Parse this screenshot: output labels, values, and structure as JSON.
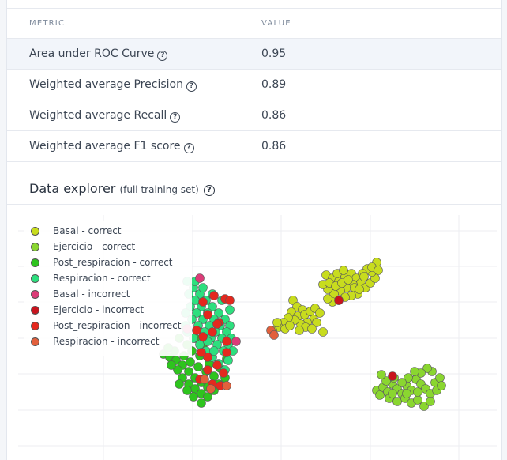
{
  "metrics_table": {
    "headers": {
      "metric": "METRIC",
      "value": "VALUE"
    },
    "rows": [
      {
        "label": "Area under ROC Curve",
        "value": "0.95"
      },
      {
        "label": "Weighted average Precision",
        "value": "0.89"
      },
      {
        "label": "Weighted average Recall",
        "value": "0.86"
      },
      {
        "label": "Weighted average F1 score",
        "value": "0.86"
      }
    ]
  },
  "help_icon_glyph": "?",
  "data_explorer": {
    "title": "Data explorer",
    "subtitle": "(full training set)"
  },
  "chart_data": {
    "type": "scatter",
    "legend_position": "top-left",
    "grid": true,
    "series": [
      {
        "name": "Basal - correct",
        "color": "#c8dc1e",
        "points": [
          [
            370,
            380
          ],
          [
            375,
            388
          ],
          [
            382,
            392
          ],
          [
            368,
            395
          ],
          [
            376,
            400
          ],
          [
            385,
            398
          ],
          [
            392,
            394
          ],
          [
            398,
            390
          ],
          [
            404,
            396
          ],
          [
            396,
            404
          ],
          [
            388,
            408
          ],
          [
            380,
            410
          ],
          [
            372,
            405
          ],
          [
            364,
            402
          ],
          [
            358,
            408
          ],
          [
            352,
            414
          ],
          [
            360,
            416
          ],
          [
            350,
            408
          ],
          [
            344,
            418
          ],
          [
            366,
            412
          ],
          [
            400,
            408
          ],
          [
            408,
            420
          ],
          [
            386,
            414
          ],
          [
            394,
            416
          ],
          [
            378,
            418
          ],
          [
            412,
            348
          ],
          [
            420,
            352
          ],
          [
            428,
            356
          ],
          [
            436,
            350
          ],
          [
            444,
            346
          ],
          [
            450,
            352
          ],
          [
            456,
            358
          ],
          [
            462,
            364
          ],
          [
            468,
            358
          ],
          [
            474,
            352
          ],
          [
            470,
            344
          ],
          [
            464,
            340
          ],
          [
            458,
            346
          ],
          [
            446,
            360
          ],
          [
            438,
            364
          ],
          [
            430,
            368
          ],
          [
            422,
            372
          ],
          [
            414,
            366
          ],
          [
            408,
            360
          ],
          [
            416,
            358
          ],
          [
            424,
            362
          ],
          [
            432,
            358
          ],
          [
            440,
            354
          ],
          [
            448,
            364
          ],
          [
            452,
            372
          ],
          [
            444,
            374
          ],
          [
            436,
            376
          ],
          [
            428,
            380
          ],
          [
            420,
            382
          ],
          [
            414,
            378
          ],
          [
            426,
            346
          ],
          [
            434,
            342
          ],
          [
            476,
            332
          ],
          [
            470,
            338
          ],
          [
            478,
            342
          ],
          [
            460,
            350
          ],
          [
            454,
            366
          ]
        ]
      },
      {
        "name": "Ejercicio - correct",
        "color": "#8ad630",
        "points": [
          [
            476,
            494
          ],
          [
            484,
            490
          ],
          [
            490,
            496
          ],
          [
            496,
            486
          ],
          [
            502,
            492
          ],
          [
            508,
            498
          ],
          [
            514,
            488
          ],
          [
            520,
            494
          ],
          [
            526,
            480
          ],
          [
            532,
            486
          ],
          [
            538,
            492
          ],
          [
            544,
            498
          ],
          [
            550,
            484
          ],
          [
            556,
            478
          ],
          [
            546,
            470
          ],
          [
            540,
            466
          ],
          [
            532,
            472
          ],
          [
            524,
            470
          ],
          [
            516,
            478
          ],
          [
            508,
            484
          ],
          [
            498,
            478
          ],
          [
            488,
            482
          ],
          [
            480,
            500
          ],
          [
            492,
            504
          ],
          [
            502,
            508
          ],
          [
            512,
            504
          ],
          [
            520,
            510
          ],
          [
            528,
            506
          ],
          [
            536,
            514
          ],
          [
            544,
            508
          ],
          [
            552,
            494
          ],
          [
            558,
            488
          ],
          [
            482,
            474
          ],
          [
            528,
            496
          ],
          [
            514,
            498
          ],
          [
            496,
            498
          ]
        ]
      },
      {
        "name": "Post_respiracion - correct",
        "color": "#2ec41e",
        "points": [
          [
            206,
            448
          ],
          [
            214,
            452
          ],
          [
            222,
            456
          ],
          [
            230,
            462
          ],
          [
            238,
            470
          ],
          [
            246,
            478
          ],
          [
            254,
            484
          ],
          [
            262,
            490
          ],
          [
            230,
            478
          ],
          [
            238,
            486
          ],
          [
            246,
            492
          ],
          [
            254,
            498
          ],
          [
            224,
            468
          ],
          [
            216,
            462
          ],
          [
            226,
            486
          ],
          [
            236,
            494
          ],
          [
            244,
            502
          ],
          [
            254,
            510
          ],
          [
            262,
            502
          ],
          [
            270,
            494
          ],
          [
            276,
            486
          ],
          [
            284,
            478
          ],
          [
            270,
            476
          ],
          [
            260,
            470
          ],
          [
            250,
            464
          ],
          [
            240,
            458
          ],
          [
            232,
            450
          ],
          [
            220,
            444
          ],
          [
            212,
            440
          ],
          [
            242,
            444
          ],
          [
            252,
            450
          ],
          [
            264,
            460
          ],
          [
            278,
            466
          ],
          [
            286,
            454
          ],
          [
            236,
            436
          ],
          [
            246,
            428
          ],
          [
            226,
            428
          ],
          [
            256,
            440
          ]
        ]
      },
      {
        "name": "Respiracion - correct",
        "color": "#2ddf7e",
        "points": [
          [
            236,
            356
          ],
          [
            244,
            364
          ],
          [
            252,
            372
          ],
          [
            260,
            380
          ],
          [
            268,
            388
          ],
          [
            276,
            396
          ],
          [
            284,
            404
          ],
          [
            290,
            412
          ],
          [
            238,
            372
          ],
          [
            246,
            380
          ],
          [
            254,
            388
          ],
          [
            262,
            396
          ],
          [
            270,
            404
          ],
          [
            278,
            412
          ],
          [
            286,
            420
          ],
          [
            240,
            388
          ],
          [
            248,
            396
          ],
          [
            256,
            404
          ],
          [
            264,
            412
          ],
          [
            272,
            420
          ],
          [
            280,
            428
          ],
          [
            288,
            436
          ],
          [
            242,
            404
          ],
          [
            250,
            412
          ],
          [
            258,
            420
          ],
          [
            266,
            428
          ],
          [
            274,
            436
          ],
          [
            282,
            444
          ],
          [
            236,
            420
          ],
          [
            244,
            428
          ],
          [
            252,
            436
          ],
          [
            260,
            444
          ],
          [
            268,
            452
          ],
          [
            276,
            460
          ],
          [
            284,
            468
          ],
          [
            290,
            392
          ],
          [
            280,
            380
          ],
          [
            268,
            372
          ],
          [
            256,
            364
          ],
          [
            246,
            356
          ],
          [
            234,
            396
          ],
          [
            234,
            412
          ],
          [
            292,
            428
          ],
          [
            294,
            444
          ],
          [
            288,
            456
          ],
          [
            262,
            432
          ],
          [
            270,
            444
          ]
        ]
      },
      {
        "name": "Basal - incorrect",
        "color": "#dc3c78",
        "points": [
          [
            252,
            352
          ],
          [
            298,
            432
          ],
          [
            236,
            416
          ]
        ]
      },
      {
        "name": "Ejercicio - incorrect",
        "color": "#c8141e",
        "points": [
          [
            428,
            380
          ],
          [
            496,
            476
          ]
        ]
      },
      {
        "name": "Post_respiracion - incorrect",
        "color": "#e4281e",
        "points": [
          [
            256,
            382
          ],
          [
            270,
            374
          ],
          [
            284,
            378
          ],
          [
            290,
            380
          ],
          [
            262,
            398
          ],
          [
            276,
            408
          ],
          [
            268,
            420
          ],
          [
            286,
            432
          ],
          [
            256,
            426
          ],
          [
            262,
            452
          ],
          [
            274,
            462
          ],
          [
            282,
            472
          ],
          [
            268,
            486
          ],
          [
            278,
            488
          ],
          [
            252,
            480
          ],
          [
            262,
            468
          ],
          [
            254,
            446
          ],
          [
            274,
            410
          ],
          [
            286,
            446
          ],
          [
            248,
            418
          ]
        ]
      },
      {
        "name": "Respiracion - incorrect",
        "color": "#e2603c",
        "points": [
          [
            342,
            418
          ],
          [
            346,
            424
          ],
          [
            258,
            480
          ],
          [
            266,
            492
          ],
          [
            286,
            488
          ]
        ]
      }
    ]
  }
}
